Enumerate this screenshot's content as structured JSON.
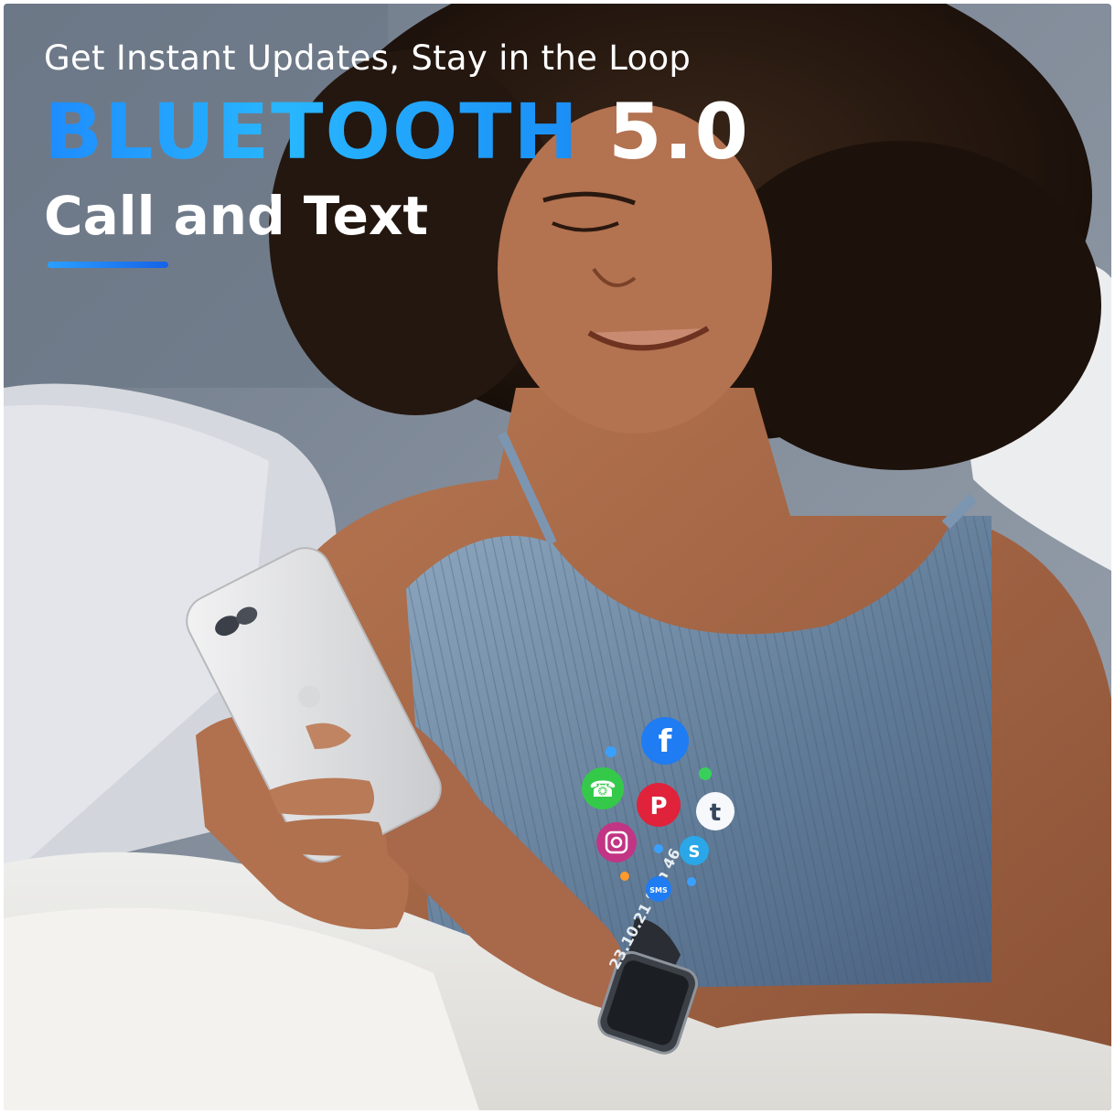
{
  "banner": {
    "tagline": "Get Instant Updates, Stay in the Loop",
    "headline_blue": "BLUETOOTH",
    "headline_white": " 5.0",
    "subheadline": "Call and Text"
  },
  "app_icons": [
    {
      "name": "facebook",
      "glyph": "f",
      "color": "#1f7cf2"
    },
    {
      "name": "phone",
      "glyph": "☎",
      "color": "#35c94a"
    },
    {
      "name": "pinterest",
      "glyph": "P",
      "color": "#e0223b"
    },
    {
      "name": "tumblr",
      "glyph": "t",
      "color": "#ffffff"
    },
    {
      "name": "instagram",
      "glyph": "◎",
      "color": "#c13584"
    },
    {
      "name": "skype",
      "glyph": "S",
      "color": "#2aa7e8"
    },
    {
      "name": "sms",
      "glyph": "SMS",
      "color": "#1f7cf2"
    }
  ],
  "watch": {
    "date": "23.10.21",
    "day": "Sun",
    "digits": "46"
  },
  "colors": {
    "accent_blue": "#1e8cff",
    "headline_white": "#ffffff"
  }
}
